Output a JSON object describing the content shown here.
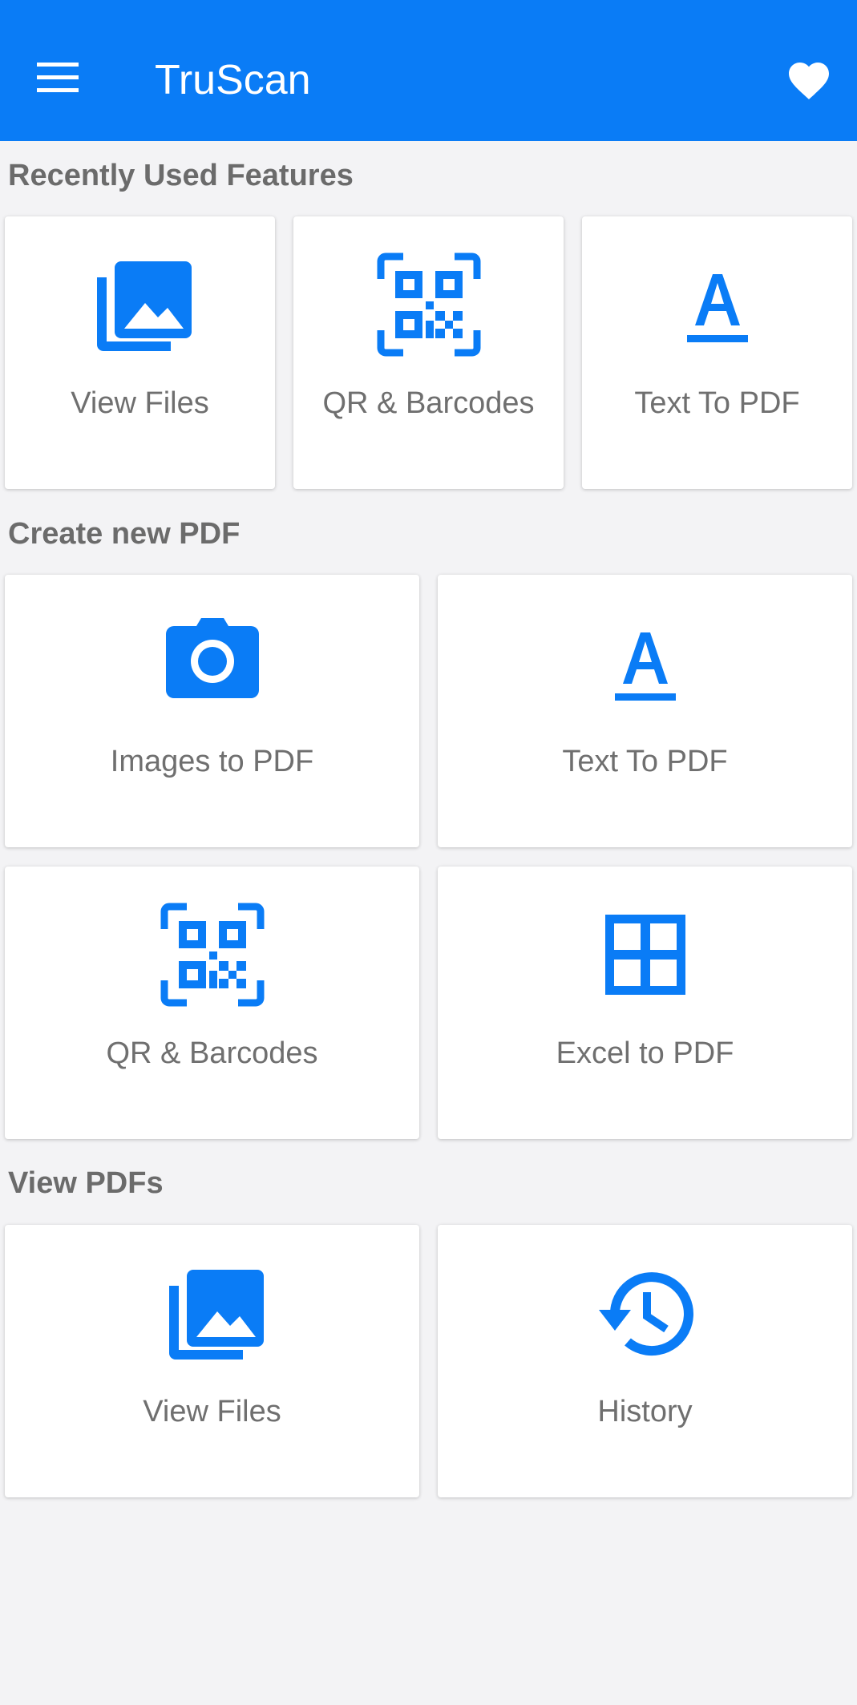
{
  "app_bar": {
    "title": "TruScan",
    "menu_icon": "hamburger-menu-icon",
    "favorite_icon": "heart-icon",
    "background": "#0a7cf6"
  },
  "accent_color": "#0a7cf6",
  "sections": {
    "recent": {
      "title": "Recently Used Features",
      "items": [
        {
          "label": "View Files",
          "icon": "image-gallery-icon"
        },
        {
          "label": "QR & Barcodes",
          "icon": "qr-code-scan-icon"
        },
        {
          "label": "Text To PDF",
          "icon": "text-format-icon"
        }
      ]
    },
    "create": {
      "title": "Create new PDF",
      "items": [
        {
          "label": "Images to PDF",
          "icon": "camera-icon"
        },
        {
          "label": "Text To PDF",
          "icon": "text-format-icon"
        },
        {
          "label": "QR & Barcodes",
          "icon": "qr-code-scan-icon"
        },
        {
          "label": "Excel to PDF",
          "icon": "grid-icon"
        }
      ]
    },
    "view": {
      "title": "View PDFs",
      "items": [
        {
          "label": "View Files",
          "icon": "image-gallery-icon"
        },
        {
          "label": "History",
          "icon": "history-icon"
        }
      ]
    }
  }
}
